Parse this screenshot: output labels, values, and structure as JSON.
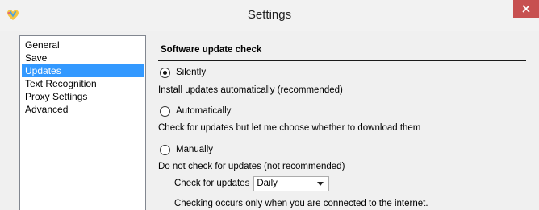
{
  "window": {
    "title": "Settings",
    "icon": "app-heart-icon",
    "close_icon": "close-icon",
    "close_color": "#c75050"
  },
  "sidebar": {
    "items": [
      {
        "label": "General",
        "selected": false
      },
      {
        "label": "Save",
        "selected": false
      },
      {
        "label": "Updates",
        "selected": true
      },
      {
        "label": "Text Recognition",
        "selected": false
      },
      {
        "label": "Proxy Settings",
        "selected": false
      },
      {
        "label": "Advanced",
        "selected": false
      }
    ],
    "selected_color": "#3399ff"
  },
  "updates": {
    "section_title": "Software update check",
    "options": [
      {
        "label": "Silently",
        "checked": true,
        "description": "Install updates automatically (recommended)"
      },
      {
        "label": "Automatically",
        "checked": false,
        "description": "Check for updates but let me choose whether to download them"
      },
      {
        "label": "Manually",
        "checked": false,
        "description": "Do not check for updates (not recommended)"
      }
    ],
    "frequency_label": "Check for updates",
    "frequency_value": "Daily",
    "note": "Checking occurs only when you are connected to the internet."
  }
}
